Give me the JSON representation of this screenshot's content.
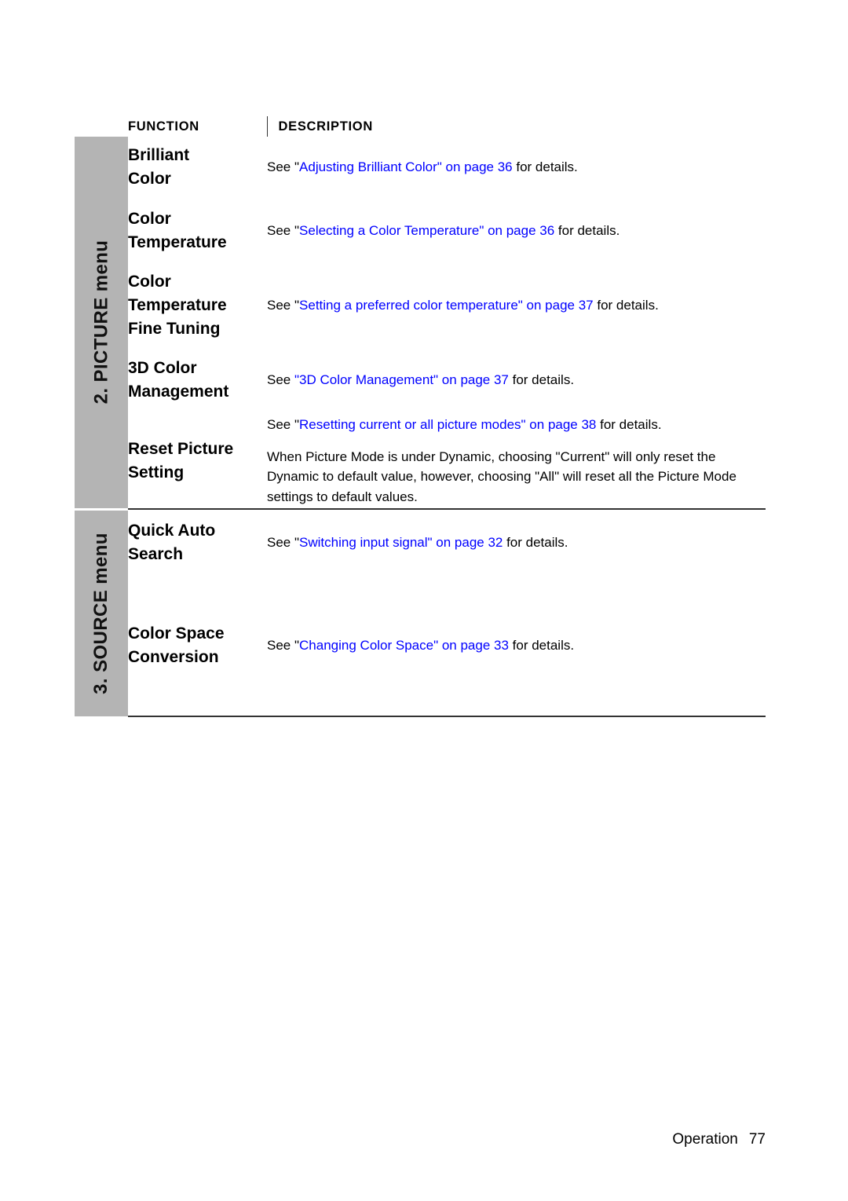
{
  "page": {
    "footer_label": "Operation",
    "footer_page_number": "77",
    "link_color": "#0000ff",
    "sidebar_color": "#b4b4b4"
  },
  "table": {
    "headers": {
      "function": "FUNCTION",
      "description": "DESCRIPTION"
    },
    "groups": [
      {
        "label": "2. PICTURE menu",
        "rows": [
          {
            "function": "Brilliant Color",
            "function_lines": [
              "Brilliant",
              "Color"
            ],
            "description_blocks": [
              {
                "segments": [
                  {
                    "text": "See ",
                    "style": "plain"
                  },
                  {
                    "text": "\"",
                    "style": "plain"
                  },
                  {
                    "text": "Adjusting Brilliant Color\" on page 36",
                    "style": "link"
                  },
                  {
                    "text": " for details.",
                    "style": "plain"
                  }
                ]
              }
            ]
          },
          {
            "function": "Color Temperature",
            "function_lines": [
              "Color",
              "Temperature"
            ],
            "description_blocks": [
              {
                "segments": [
                  {
                    "text": "See ",
                    "style": "plain"
                  },
                  {
                    "text": "\"",
                    "style": "plain"
                  },
                  {
                    "text": "Selecting a Color Temperature\" on page 36",
                    "style": "link"
                  },
                  {
                    "text": " for details.",
                    "style": "plain"
                  }
                ]
              }
            ]
          },
          {
            "function": "Color Temperature Fine Tuning",
            "function_lines": [
              "Color",
              "Temperature",
              "Fine Tuning"
            ],
            "description_blocks": [
              {
                "segments": [
                  {
                    "text": "See ",
                    "style": "plain"
                  },
                  {
                    "text": "\"",
                    "style": "plain"
                  },
                  {
                    "text": "Setting a preferred color temperature\" on page 37",
                    "style": "link"
                  },
                  {
                    "text": " for details.",
                    "style": "plain"
                  }
                ]
              }
            ]
          },
          {
            "function": "3D Color Management",
            "function_lines": [
              "3D Color",
              "Management"
            ],
            "description_blocks": [
              {
                "segments": [
                  {
                    "text": "See ",
                    "style": "plain"
                  },
                  {
                    "text": "\"3D Color Management\" on page 37",
                    "style": "link"
                  },
                  {
                    "text": " for details.",
                    "style": "plain"
                  }
                ]
              }
            ]
          },
          {
            "function": "Reset Picture Setting",
            "function_lines": [
              "Reset Picture",
              "Setting"
            ],
            "description_blocks": [
              {
                "segments": [
                  {
                    "text": "See ",
                    "style": "plain"
                  },
                  {
                    "text": "\"",
                    "style": "plain"
                  },
                  {
                    "text": "Resetting current or all picture modes\" on page 38",
                    "style": "link"
                  },
                  {
                    "text": " for details.",
                    "style": "plain"
                  }
                ]
              },
              {
                "segments": [
                  {
                    "text": "When Picture Mode is under Dynamic, choosing \"Current\" will only reset the Dynamic to default value, however, choosing \"All\" will reset all the Picture Mode settings to default values.",
                    "style": "plain"
                  }
                ]
              }
            ]
          }
        ]
      },
      {
        "label": "3. SOURCE menu",
        "rows": [
          {
            "function": "Quick Auto Search",
            "function_lines": [
              "Quick Auto",
              "Search"
            ],
            "description_blocks": [
              {
                "segments": [
                  {
                    "text": "See ",
                    "style": "plain"
                  },
                  {
                    "text": "\"",
                    "style": "plain"
                  },
                  {
                    "text": "Switching input signal\" on page 32",
                    "style": "link"
                  },
                  {
                    "text": " for details.",
                    "style": "plain"
                  }
                ]
              }
            ]
          },
          {
            "function": "Color Space Conversion",
            "function_lines": [
              "Color Space",
              "Conversion"
            ],
            "description_blocks": [
              {
                "segments": [
                  {
                    "text": "See ",
                    "style": "plain"
                  },
                  {
                    "text": "\"",
                    "style": "plain"
                  },
                  {
                    "text": "Changing Color Space\" on page 33",
                    "style": "link"
                  },
                  {
                    "text": " for details.",
                    "style": "plain"
                  }
                ]
              }
            ]
          }
        ]
      }
    ]
  }
}
